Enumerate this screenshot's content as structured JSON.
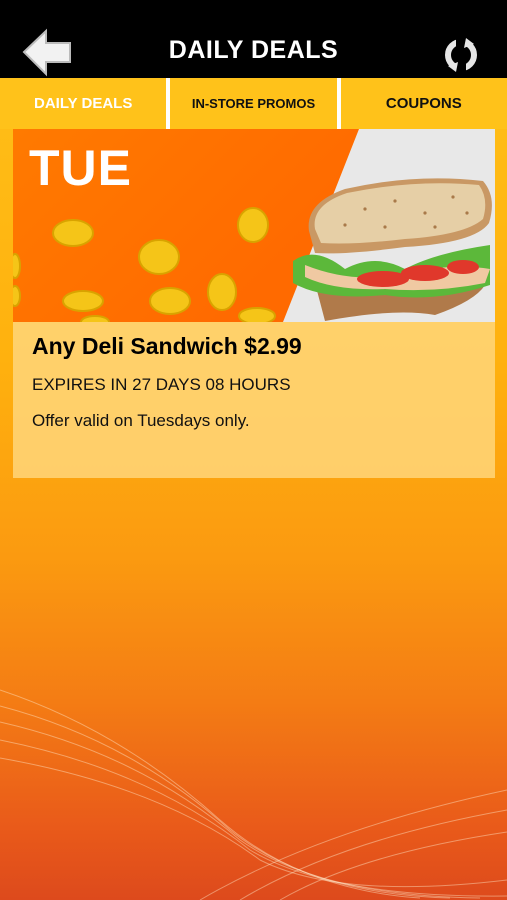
{
  "header": {
    "title": "DAILY DEALS",
    "back_icon": "back-arrow-icon",
    "refresh_icon": "refresh-icon"
  },
  "tabs": [
    {
      "label": "DAILY DEALS",
      "active": true
    },
    {
      "label": "IN-STORE PROMOS",
      "active": false
    },
    {
      "label": "COUPONS",
      "active": false
    }
  ],
  "deal": {
    "day": "TUE",
    "title": "Any Deli Sandwich $2.99",
    "expires": "EXPIRES IN 27 DAYS 08 HOURS",
    "description": "Offer valid on Tuesdays only."
  },
  "colors": {
    "header_bg": "#000000",
    "tab_bg": "#ffc21a",
    "banner_orange": "#ff6a00",
    "background_top": "#ffc21a",
    "background_bottom": "#dd4a1c"
  }
}
